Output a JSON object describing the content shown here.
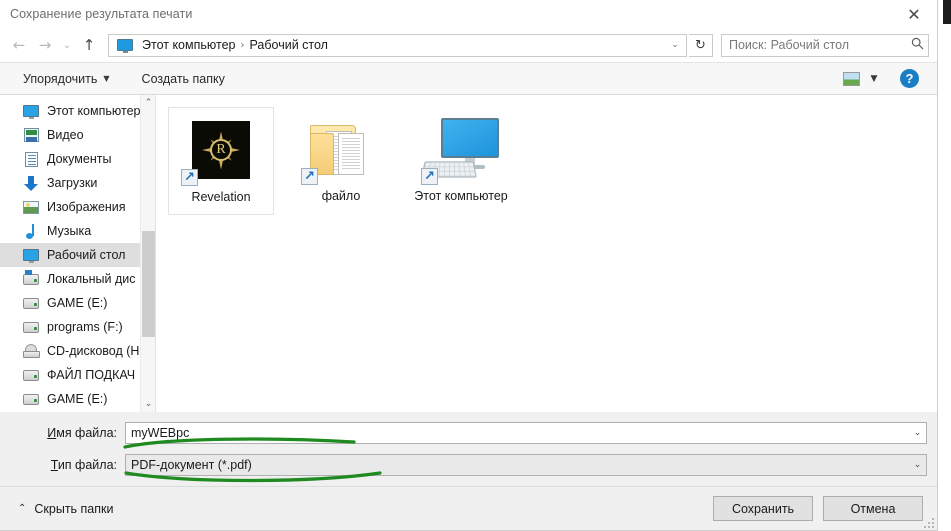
{
  "window": {
    "title": "Сохранение результата печати",
    "close_label": "✕"
  },
  "nav": {
    "back_icon": "←",
    "forward_icon": "→",
    "history_icon": "⌄",
    "up_icon": "↑",
    "refresh_icon": "↻",
    "address_icon": "this-pc-icon",
    "breadcrumbs": [
      "Этот компьютер",
      "Рабочий стол"
    ],
    "separator": "›",
    "dropdown_icon": "⌄"
  },
  "search": {
    "placeholder": "Поиск: Рабочий стол",
    "value": "",
    "icon": "🔍"
  },
  "command_bar": {
    "organize_label": "Упорядочить",
    "organize_caret": "▼",
    "new_folder_label": "Создать папку",
    "view_caret": "▼",
    "help_label": "?"
  },
  "sidebar": {
    "items": [
      {
        "label": "Этот компьютер",
        "icon": "monitor-icon",
        "selected": false
      },
      {
        "label": "Видео",
        "icon": "video-icon",
        "selected": false
      },
      {
        "label": "Документы",
        "icon": "documents-icon",
        "selected": false
      },
      {
        "label": "Загрузки",
        "icon": "downloads-icon",
        "selected": false
      },
      {
        "label": "Изображения",
        "icon": "pictures-icon",
        "selected": false
      },
      {
        "label": "Музыка",
        "icon": "music-icon",
        "selected": false
      },
      {
        "label": "Рабочий стол",
        "icon": "desktop-icon",
        "selected": true
      },
      {
        "label": "Локальный дис",
        "icon": "system-drive-icon",
        "selected": false
      },
      {
        "label": "GAME (E:)",
        "icon": "drive-icon",
        "selected": false
      },
      {
        "label": "programs (F:)",
        "icon": "drive-icon",
        "selected": false
      },
      {
        "label": "CD-дисковод (H",
        "icon": "cd-drive-icon",
        "selected": false
      },
      {
        "label": "ФАЙЛ ПОДКАЧ",
        "icon": "drive-icon",
        "selected": false
      },
      {
        "label": "GAME (E:)",
        "icon": "drive-icon",
        "selected": false
      }
    ],
    "scroll_up_icon": "⌃",
    "scroll_down_icon": "⌄"
  },
  "files": {
    "items": [
      {
        "name": "Revelation",
        "icon": "revelation-app-icon",
        "shortcut": true,
        "selected": true
      },
      {
        "name": "файло",
        "icon": "folder-documents-icon",
        "shortcut": true,
        "selected": false
      },
      {
        "name": "Этот компьютер",
        "icon": "this-pc-icon",
        "shortcut": true,
        "selected": false
      }
    ]
  },
  "footer": {
    "filename_label": "Имя файла:",
    "filename_label_accel": "И",
    "filename_label_rest": "мя файла:",
    "filename_value": "myWEBpc",
    "filetype_label_accel": "Т",
    "filetype_label_rest": "ип файла:",
    "filetype_value": "PDF-документ (*.pdf)",
    "combo_caret": "⌄",
    "hide_folders_label": "Скрыть папки",
    "hide_folders_caret": "⌃",
    "save_label": "Сохранить",
    "cancel_label": "Отмена"
  },
  "annotations": {
    "color": "#1f8a1f",
    "marks": [
      "underline-filename",
      "underline-filetype"
    ]
  }
}
